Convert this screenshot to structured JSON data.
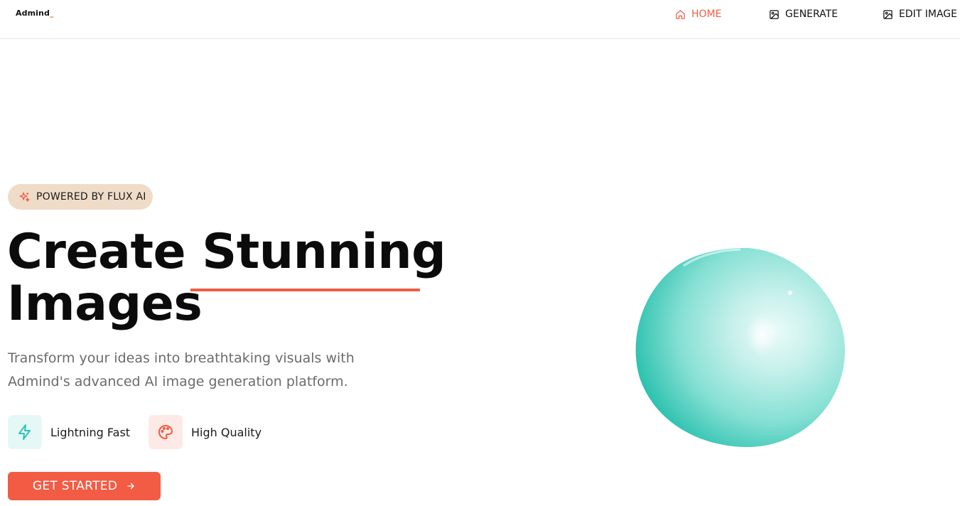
{
  "header": {
    "logo": "Admind",
    "logo_cursor": "_",
    "nav": [
      {
        "label": "HOME",
        "icon": "home-icon",
        "active": true
      },
      {
        "label": "GENERATE",
        "icon": "image-icon",
        "active": false
      },
      {
        "label": "EDIT IMAGE",
        "icon": "image-icon",
        "active": false
      }
    ]
  },
  "hero": {
    "badge": {
      "icon": "sparkles-icon",
      "label": "POWERED BY FLUX AI"
    },
    "headline_line1": "Create Stunning",
    "headline_line2": "Images",
    "subtitle": "Transform your ideas into breathtaking visuals with Admind's advanced AI image generation platform.",
    "features": [
      {
        "label": "Lightning Fast",
        "icon": "lightning-icon"
      },
      {
        "label": "High Quality",
        "icon": "palette-icon"
      }
    ],
    "cta": {
      "label": "GET STARTED",
      "icon": "arrow-right-icon"
    }
  },
  "colors": {
    "accent": "#f25c44",
    "badge_bg": "#efdcc8",
    "teal": "#2ec4b6",
    "blob": "#7fe0d3"
  }
}
